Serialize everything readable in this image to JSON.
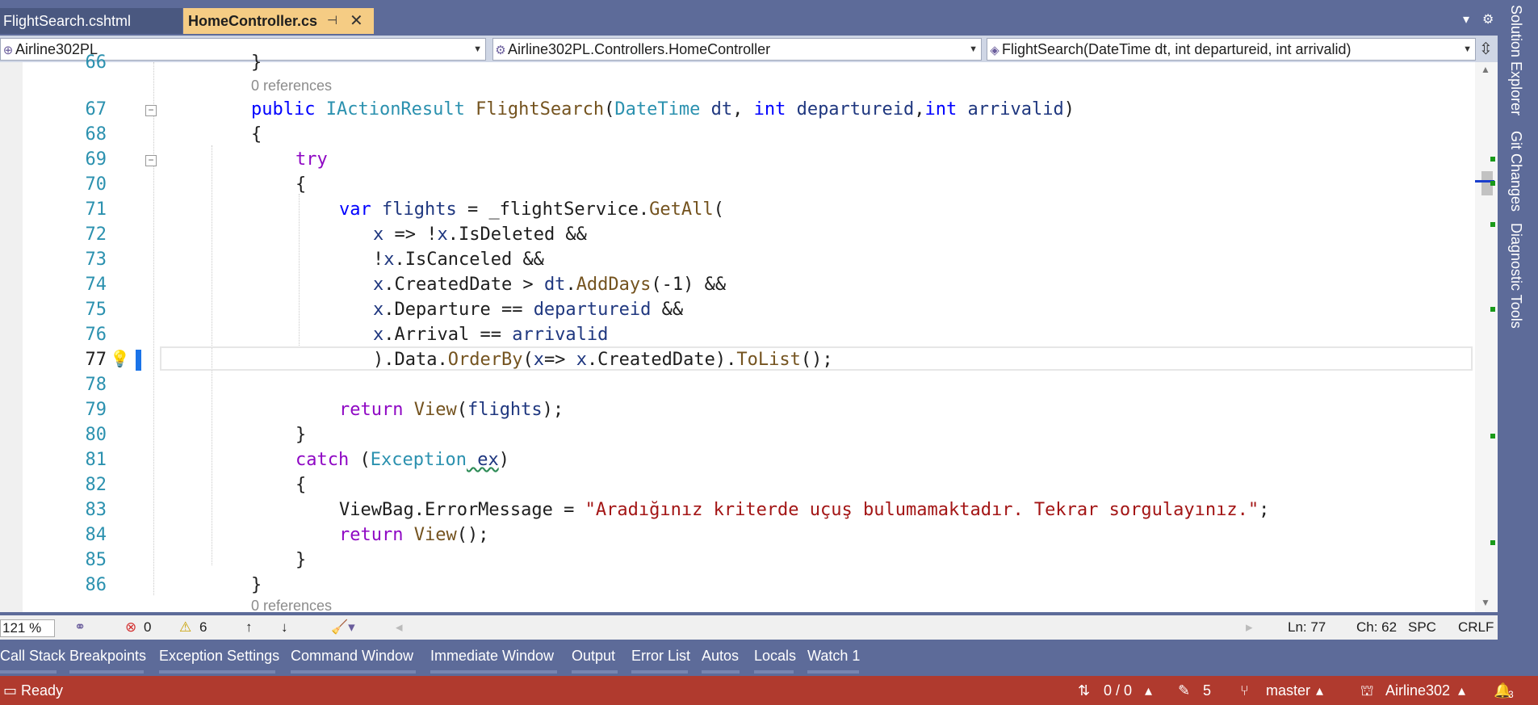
{
  "tabs": [
    {
      "label": "FlightSearch.cshtml"
    },
    {
      "label": "HomeController.cs"
    }
  ],
  "navbar": {
    "project": "Airline302PL",
    "class": "Airline302PL.Controllers.HomeController",
    "member": "FlightSearch(DateTime dt, int departureid, int arrivalid)"
  },
  "editor": {
    "partial_line_number": "66",
    "references_top": "0 references",
    "references_bottom": "0 references",
    "lines": [
      {
        "n": "67"
      },
      {
        "n": "68"
      },
      {
        "n": "69"
      },
      {
        "n": "70"
      },
      {
        "n": "71"
      },
      {
        "n": "72"
      },
      {
        "n": "73"
      },
      {
        "n": "74"
      },
      {
        "n": "75"
      },
      {
        "n": "76"
      },
      {
        "n": "77"
      },
      {
        "n": "78"
      },
      {
        "n": "79"
      },
      {
        "n": "80"
      },
      {
        "n": "81"
      },
      {
        "n": "82"
      },
      {
        "n": "83"
      },
      {
        "n": "84"
      },
      {
        "n": "85"
      },
      {
        "n": "86"
      }
    ],
    "code": {
      "l67_kw": "public ",
      "l67_type": "IActionResult ",
      "l67_fn": "FlightSearch",
      "l67_p1": "(",
      "l67_t1": "DateTime",
      "l67_a1": " dt",
      "l67_c1": ", ",
      "l67_k2": "int",
      "l67_a2": " departureid",
      "l67_c2": ",",
      "l67_k3": "int",
      "l67_a3": " arrivalid",
      "l67_end": ")",
      "l68": "{",
      "l69": "try",
      "l70": "{",
      "l71_kw": "var ",
      "l71_var": "flights",
      "l71_rest": " = _flightService.",
      "l71_fn": "GetAll",
      "l71_end": "(",
      "l72_x": "x",
      "l72_rest": " => !",
      "l72_x2": "x",
      "l72_tail": ".IsDeleted &&",
      "l73_pre": "!",
      "l73_x": "x",
      "l73_tail": ".IsCanceled &&",
      "l74_x": "x",
      "l74_mid": ".CreatedDate > ",
      "l74_dt": "dt",
      "l74_dot": ".",
      "l74_fn": "AddDays",
      "l74_tail": "(-1) &&",
      "l75_x": "x",
      "l75_mid": ".Departure == ",
      "l75_p": "departureid",
      "l75_tail": " &&",
      "l76_x": "x",
      "l76_mid": ".Arrival == ",
      "l76_p": "arrivalid",
      "l77_pre": ").Data.",
      "l77_fn": "OrderBy",
      "l77_mid": "(",
      "l77_x": "x",
      "l77_arrow": "=> ",
      "l77_x2": "x",
      "l77_cd": ".CreatedDate).",
      "l77_fn2": "ToList",
      "l77_end": "();",
      "l79_kw": "return ",
      "l79_fn": "View",
      "l79_p": "(",
      "l79_v": "flights",
      "l79_end": ");",
      "l80": "}",
      "l81_kw": "catch",
      "l81_p": " (",
      "l81_t": "Exception",
      "l81_v": " ex",
      "l81_end": ")",
      "l82": "{",
      "l83_pre": "ViewBag.ErrorMessage = ",
      "l83_str": "\"Aradığınız kriterde uçuş bulumamaktadır. Tekrar sorgulayınız.\"",
      "l83_end": ";",
      "l84_kw": "return ",
      "l84_fn": "View",
      "l84_end": "();",
      "l85": "}",
      "l86": "}"
    }
  },
  "editor_status": {
    "zoom": "121 %",
    "errors": "0",
    "warnings": "6",
    "ln": "Ln: 77",
    "ch": "Ch: 62",
    "spc": "SPC",
    "crlf": "CRLF"
  },
  "tool_tabs": [
    {
      "label": "Call Stack"
    },
    {
      "label": "Breakpoints"
    },
    {
      "label": "Exception Settings"
    },
    {
      "label": "Command Window"
    },
    {
      "label": "Immediate Window"
    },
    {
      "label": "Output"
    },
    {
      "label": "Error List"
    },
    {
      "label": "Autos"
    },
    {
      "label": "Locals"
    },
    {
      "label": "Watch 1"
    }
  ],
  "statusbar": {
    "ready": "Ready",
    "sync": "0 / 0",
    "pending": "5",
    "branch": "master",
    "repo": "Airline302",
    "notifications": "3"
  },
  "side_panels": [
    {
      "label": "Solution Explorer"
    },
    {
      "label": "Git Changes"
    },
    {
      "label": "Diagnostic Tools"
    }
  ],
  "colors": {
    "accent_tab": "#f5cc84",
    "statusbar": "#b03a2e",
    "chrome": "#5d6b99"
  }
}
